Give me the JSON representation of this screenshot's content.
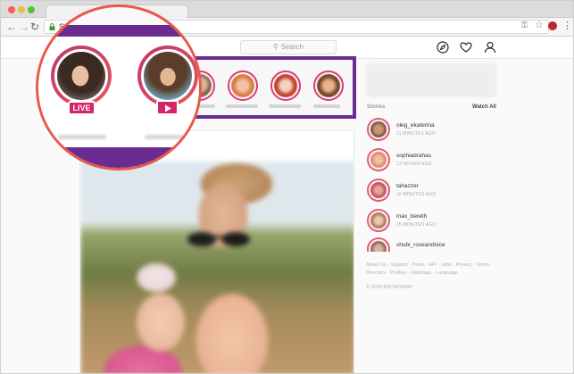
{
  "browser": {
    "url": "Se",
    "colors": {
      "close": "#fc5b57",
      "minimize": "#e5bf3c",
      "maximize": "#57c038"
    },
    "icons": [
      "back-icon",
      "forward-icon",
      "reload-icon",
      "lock-icon",
      "key-icon",
      "star-icon",
      "extension-icon",
      "menu-icon"
    ]
  },
  "header": {
    "search_placeholder": "Search",
    "icons": [
      "compass-icon",
      "heart-icon",
      "profile-icon"
    ]
  },
  "zoom": {
    "live_label": "LIVE",
    "accent_color": "#e8594a",
    "highlight_color": "#6a2c91"
  },
  "sidebar": {
    "stories_title": "Stories",
    "watch_all": "Watch All",
    "stories": [
      {
        "name": "oleg_ekaterina",
        "ago": "11 MINUTES AGO"
      },
      {
        "name": "sophiadrahas",
        "ago": "13 HOURS AGO"
      },
      {
        "name": "tahazzer",
        "ago": "16 MINUTES AGO"
      },
      {
        "name": "max_bereth",
        "ago": "25 MINUTES AGO"
      },
      {
        "name": "shubi_roseandnice",
        "ago": ""
      }
    ],
    "footer_links": "About Us · Support · Press · API · Jobs · Privacy · Terms · Directory · Profiles · Hashtags · Language",
    "copyright": "© 2018 INSTAGRAM"
  }
}
